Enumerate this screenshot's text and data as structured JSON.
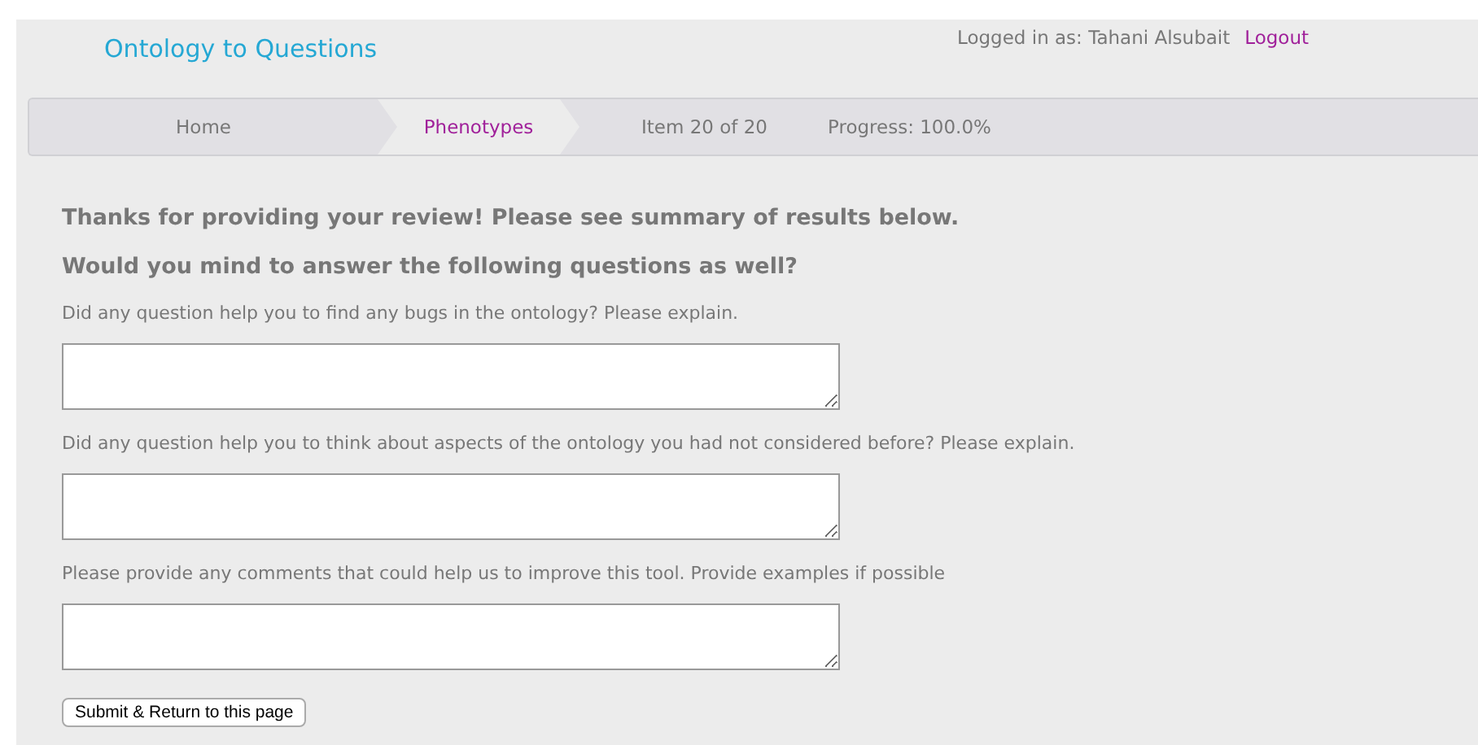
{
  "header": {
    "title": "Ontology to Questions",
    "logged_in": "Logged in as: Tahani Alsubait",
    "logout": "Logout"
  },
  "nav": {
    "tabs": [
      {
        "label": "Home",
        "selected": false
      },
      {
        "label": "Phenotypes",
        "selected": true
      }
    ],
    "item": "Item 20 of 20",
    "progress": "Progress: 100.0%"
  },
  "content": {
    "headings": [
      "Thanks for providing your review! Please see summary of results below.",
      "Would you mind to answer the following questions as well?"
    ],
    "questions": [
      {
        "label": "Did any question help you to find any bugs in the ontology? Please explain."
      },
      {
        "label": "Did any question help you to think about aspects of the ontology you had not considered before? Please explain."
      },
      {
        "label": "Please provide any comments that could help us to improve this tool. Provide examples if possible"
      }
    ],
    "submit": "Submit & Return to this page"
  }
}
